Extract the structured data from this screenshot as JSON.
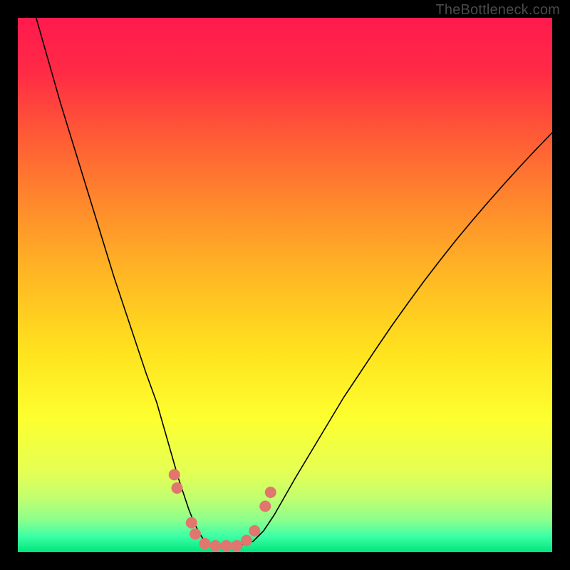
{
  "watermark": "TheBottleneck.com",
  "chart_data": {
    "type": "line",
    "title": "",
    "xlabel": "",
    "ylabel": "",
    "xlim": [
      0,
      100
    ],
    "ylim": [
      0,
      100
    ],
    "grid": false,
    "legend": false,
    "series": [
      {
        "name": "V-curve",
        "color": "#000000",
        "stroke_width": 1.6,
        "x": [
          0,
          2,
          4,
          6,
          8,
          10,
          12,
          14,
          16,
          18,
          20,
          22,
          24,
          26,
          27,
          28,
          29,
          30,
          31,
          32,
          33,
          34,
          35,
          36,
          38,
          40,
          42,
          44,
          46,
          48,
          50,
          52,
          55,
          58,
          61,
          64,
          67,
          70,
          73,
          76,
          79,
          82,
          85,
          88,
          91,
          94,
          97,
          100
        ],
        "y": [
          113,
          105,
          98,
          91,
          84,
          77.5,
          71,
          64.5,
          58,
          51.5,
          45.5,
          39.5,
          33.5,
          28,
          24.5,
          21,
          17.5,
          14,
          11,
          8,
          5.5,
          3.5,
          2,
          1.4,
          1.2,
          1.2,
          1.4,
          2,
          4,
          7,
          10.5,
          14,
          19,
          24,
          29,
          33.5,
          38,
          42.4,
          46.6,
          50.7,
          54.6,
          58.4,
          62,
          65.5,
          68.9,
          72.2,
          75.4,
          78.5
        ]
      }
    ],
    "annotations": [
      {
        "name": "marker-cluster",
        "color": "#e0766d",
        "radius": 8,
        "points": [
          {
            "x": 29.3,
            "y": 14.5
          },
          {
            "x": 29.8,
            "y": 12.0
          },
          {
            "x": 32.5,
            "y": 5.5
          },
          {
            "x": 33.2,
            "y": 3.4
          },
          {
            "x": 35.0,
            "y": 1.6
          },
          {
            "x": 37.0,
            "y": 1.2
          },
          {
            "x": 39.0,
            "y": 1.2
          },
          {
            "x": 41.0,
            "y": 1.2
          },
          {
            "x": 42.8,
            "y": 2.2
          },
          {
            "x": 44.3,
            "y": 4.0
          },
          {
            "x": 46.3,
            "y": 8.6
          },
          {
            "x": 47.3,
            "y": 11.2
          }
        ]
      }
    ]
  }
}
